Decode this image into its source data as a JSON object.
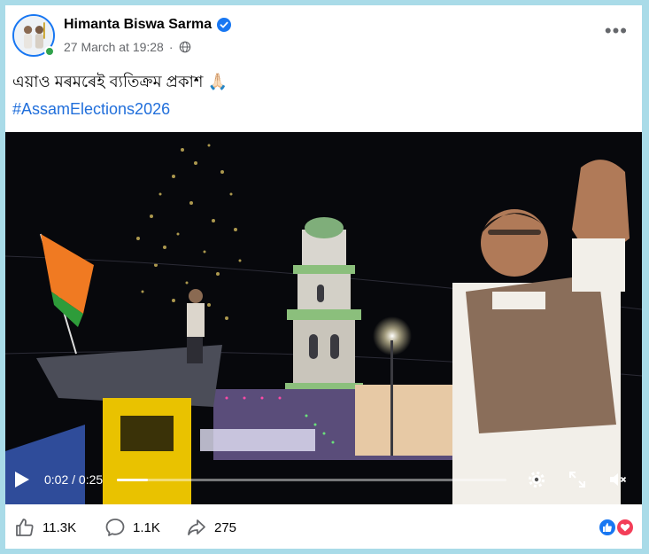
{
  "post": {
    "author": "Himanta Biswa Sarma",
    "date": "27 March at 19:28",
    "text": "এয়াও মৰমৰেই ব্যতিক্ৰম প্ৰকাশ 🙏🏻",
    "hashtag": "#AssamElections2026"
  },
  "video": {
    "time_display": "0:02 / 0:25",
    "progress": 0.08
  },
  "actions": {
    "likes": "11.3K",
    "comments": "1.1K",
    "shares": "275"
  },
  "icons": {
    "verified": "verified-badge-icon",
    "privacy": "globe-icon",
    "more": "more-options-icon",
    "play": "play-icon",
    "settings": "gear-icon",
    "fullscreen": "fullscreen-icon",
    "volume": "volume-muted-icon",
    "like": "thumbs-up-icon",
    "comment": "comment-bubble-icon",
    "share": "share-arrow-icon",
    "reaction_like": "like-reaction-icon",
    "reaction_love": "love-reaction-icon"
  },
  "colors": {
    "brand_blue": "#1877f2",
    "hashtag_blue": "#216fdb",
    "love_red": "#f33e58",
    "online_green": "#31a24c",
    "secondary_text": "#65676b",
    "page_border": "#a9dbe8"
  }
}
